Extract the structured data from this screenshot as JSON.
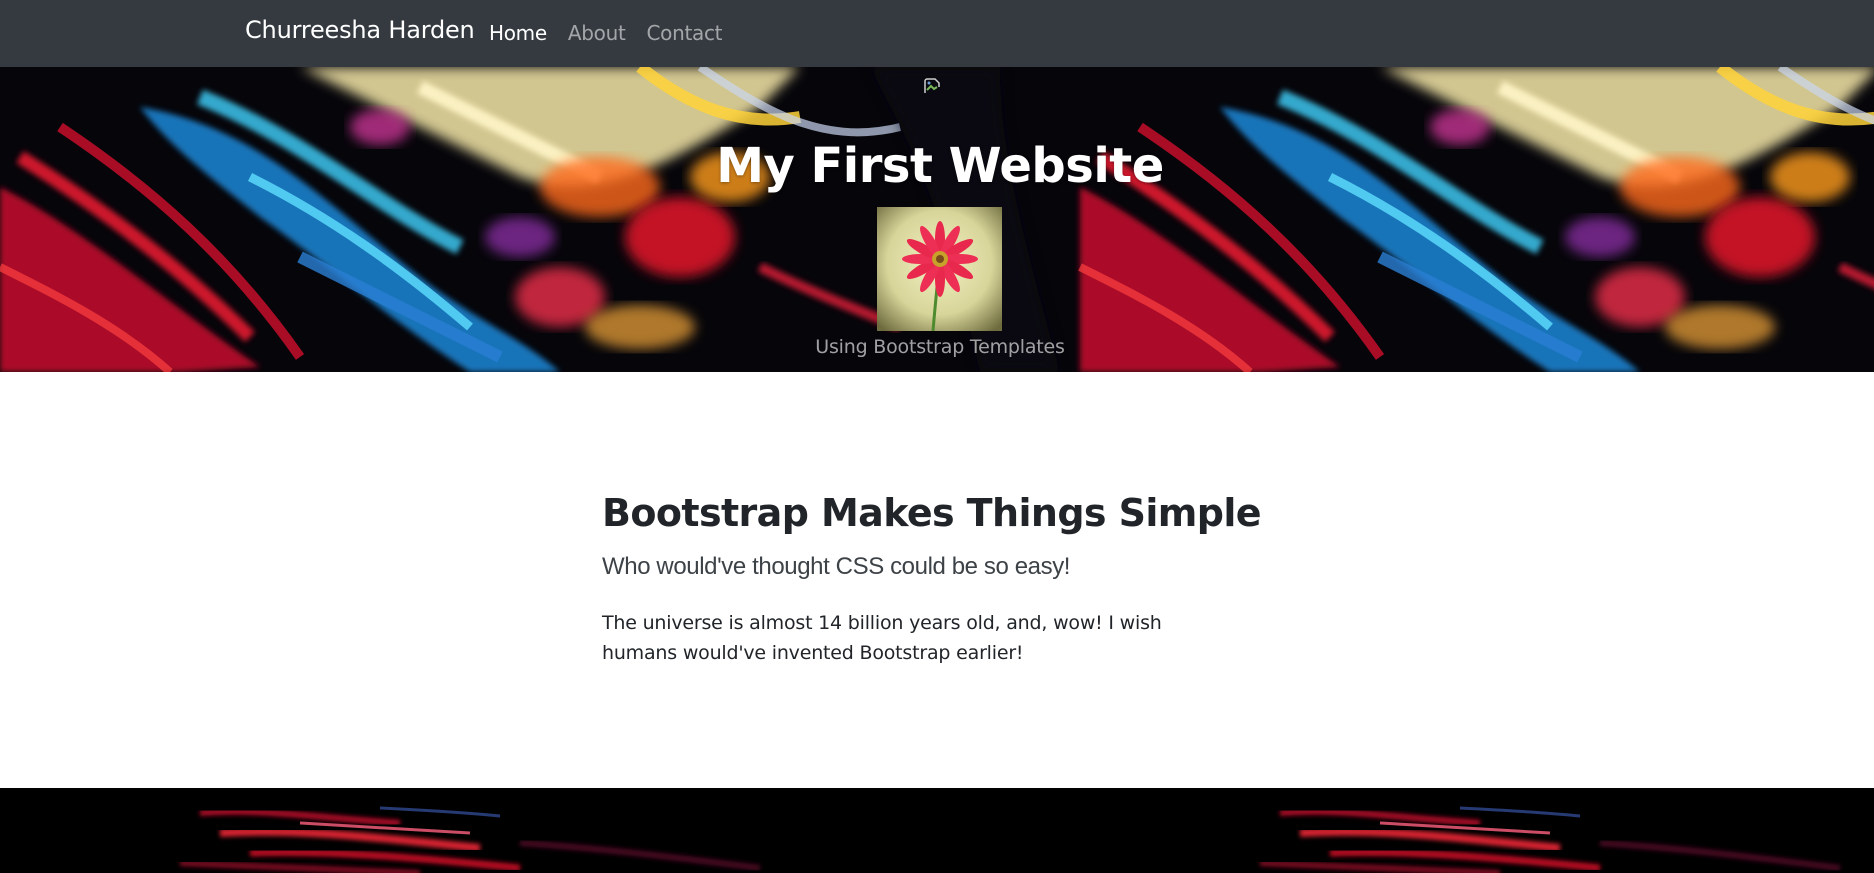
{
  "navbar": {
    "brand": "Churreesha Harden",
    "links": [
      {
        "label": "Home",
        "active": true
      },
      {
        "label": "About",
        "active": false
      },
      {
        "label": "Contact",
        "active": false
      }
    ],
    "background": "#343a40"
  },
  "hero": {
    "title": "My First Website",
    "subtitle": "Using Bootstrap Templates",
    "background_image": "colorful-abstract-paint-splash",
    "image": "pink-gerbera-flower"
  },
  "main": {
    "heading": "Bootstrap Makes Things Simple",
    "lead": "Who would've thought CSS could be so easy!",
    "body": "The universe is almost 14 billion years old, and, wow! I wish humans would've invented Bootstrap earlier!"
  },
  "footer": {
    "background_image": "dark-red-paint-streaks"
  },
  "colors": {
    "text": "#212529",
    "navbar": "#343a40",
    "white": "#ffffff"
  }
}
